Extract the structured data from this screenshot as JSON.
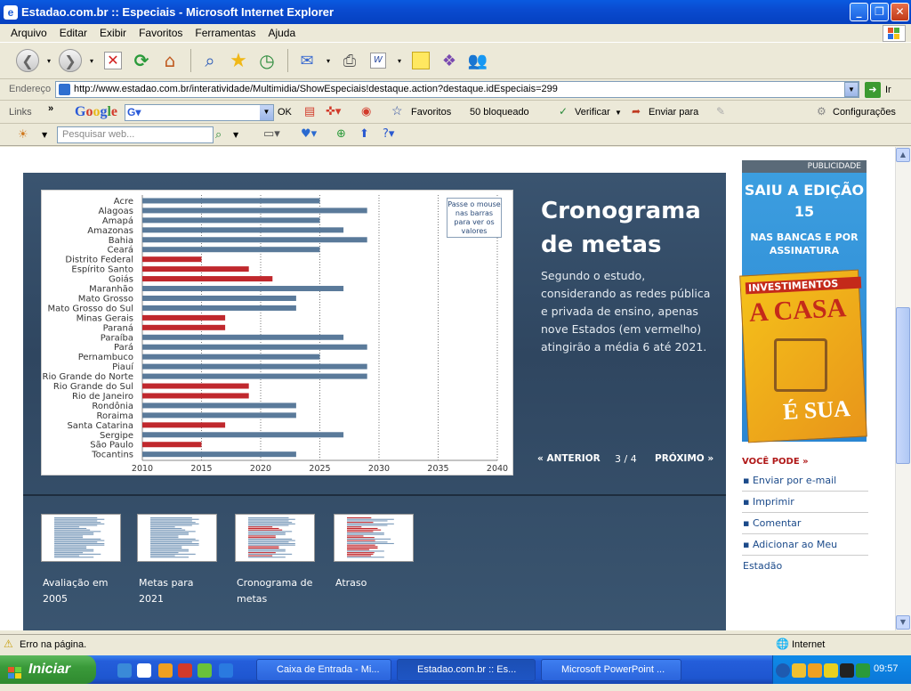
{
  "window": {
    "title": "Estadao.com.br :: Especiais - Microsoft Internet Explorer",
    "menu": [
      "Arquivo",
      "Editar",
      "Exibir",
      "Favoritos",
      "Ferramentas",
      "Ajuda"
    ]
  },
  "address": {
    "label": "Endereço",
    "url": "http://www.estadao.com.br/interatividade/Multimidia/ShowEspeciais!destaque.action?destaque.idEspeciais=299",
    "go": "Ir"
  },
  "links_bar": {
    "links": "Links",
    "google": "Google",
    "ok": "OK",
    "favoritos": "Favoritos",
    "bloqueado": "50 bloqueado",
    "verificar": "Verificar",
    "enviar": "Enviar para",
    "config": "Configurações"
  },
  "search_bar": {
    "placeholder": "Pesquisar web..."
  },
  "slide": {
    "title_line1": "Cronograma",
    "title_line2": "de metas",
    "description": "Segundo o estudo, considerando as redes pública e privada de ensino, apenas nove Estados (em vermelho) atingirão a média 6 até 2021.",
    "tooltip": "Passe o mouse nas barras para ver os valores",
    "prev": "ANTERIOR",
    "counter": "3 / 4",
    "next": "PRÓXIMO"
  },
  "thumbnails": [
    {
      "label": "Avaliação em 2005"
    },
    {
      "label": "Metas para 2021"
    },
    {
      "label": "Cronograma de metas"
    },
    {
      "label": "Atraso"
    }
  ],
  "ad": {
    "header": "PUBLICIDADE",
    "line1": "SAIU A EDIÇÃO 15",
    "line2": "NAS BANCAS E POR ASSINATURA",
    "mag_title": "INVESTIMENTOS",
    "mag_casa": "A CASA",
    "mag_sua": "É SUA"
  },
  "sidebar": {
    "heading": "VOCÊ PODE",
    "links": [
      "Enviar por e-mail",
      "Imprimir",
      "Comentar",
      "Adicionar ao Meu Estadão"
    ]
  },
  "status": {
    "message": "Erro na página.",
    "zone": "Internet"
  },
  "taskbar": {
    "start": "Iniciar",
    "items": [
      "Caixa de Entrada - Mi...",
      "Estadao.com.br :: Es...",
      "Microsoft PowerPoint ..."
    ],
    "clock": "09:57"
  },
  "colors": {
    "blue_bar": "#5a7a9a",
    "red_bar": "#c0282d",
    "panel": "#34506a"
  },
  "chart_data": {
    "type": "bar",
    "orientation": "horizontal",
    "categories": [
      "Acre",
      "Alagoas",
      "Amapá",
      "Amazonas",
      "Bahia",
      "Ceará",
      "Distrito Federal",
      "Espírito Santo",
      "Goiás",
      "Maranhão",
      "Mato Grosso",
      "Mato Grosso do Sul",
      "Minas Gerais",
      "Paraná",
      "Paraíba",
      "Pará",
      "Pernambuco",
      "Piauí",
      "Rio Grande do Norte",
      "Rio Grande do Sul",
      "Rio de Janeiro",
      "Rondônia",
      "Roraima",
      "Santa Catarina",
      "Sergipe",
      "São Paulo",
      "Tocantins"
    ],
    "values": [
      2025,
      2029,
      2025,
      2027,
      2029,
      2025,
      2015,
      2019,
      2021,
      2027,
      2023,
      2023,
      2017,
      2017,
      2027,
      2029,
      2025,
      2029,
      2029,
      2019,
      2019,
      2023,
      2023,
      2017,
      2027,
      2015,
      2023
    ],
    "highlight": [
      false,
      false,
      false,
      false,
      false,
      false,
      true,
      true,
      true,
      false,
      false,
      false,
      true,
      true,
      false,
      false,
      false,
      false,
      false,
      true,
      true,
      false,
      false,
      true,
      false,
      true,
      false
    ],
    "xlim": [
      2010,
      2040
    ],
    "xticks": [
      2010,
      2015,
      2020,
      2025,
      2030,
      2035,
      2040
    ]
  }
}
